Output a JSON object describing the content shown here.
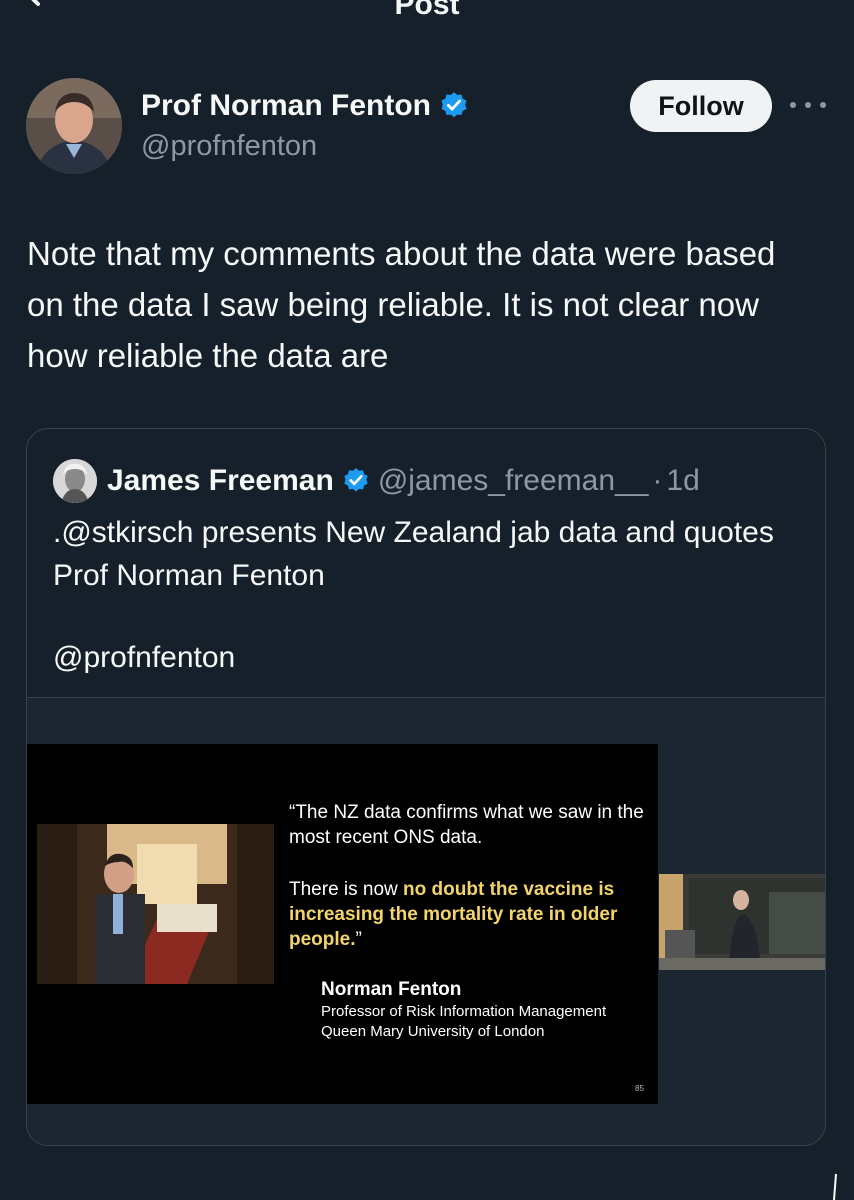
{
  "header": {
    "title": "Post",
    "back_icon": "arrow-left-icon"
  },
  "author": {
    "name": "Prof Norman Fenton",
    "handle": "@profnfenton",
    "verified_color": "#1d9bf0",
    "follow_label": "Follow",
    "more_icon": "more-horizontal-icon"
  },
  "post": {
    "text": "Note that my comments about the data were based on the data I saw being reliable. It is not clear now how reliable the data are"
  },
  "quote": {
    "name": "James Freeman",
    "handle": "@james_freeman__",
    "separator": "·",
    "time": "1d",
    "text": ".@stkirsch presents New Zealand jab data and quotes Prof Norman Fenton",
    "mention": "@profnfenton",
    "media": {
      "quote_line1": "“The NZ data confirms what we saw in the most recent ONS data.",
      "quote_line2_pre": "There is now ",
      "quote_line2_highlight": "no doubt the vaccine is increasing the mortality rate in older people.",
      "quote_line2_post": "”",
      "author_name": "Norman Fenton",
      "author_title": "Professor of Risk Information Management",
      "author_org": "Queen Mary University of London",
      "slide_number": "85",
      "highlight_color": "#f3d36b"
    }
  }
}
